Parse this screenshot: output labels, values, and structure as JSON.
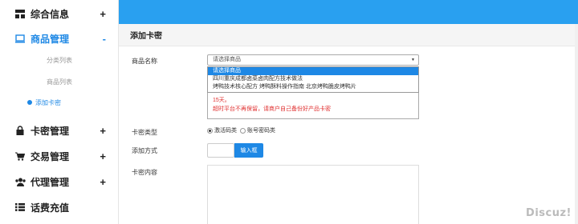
{
  "sidebar": {
    "groups": [
      {
        "label": "综合信息",
        "toggle": "+",
        "icon": "dashboard-icon"
      },
      {
        "label": "商品管理",
        "toggle": "-",
        "icon": "monitor-icon",
        "active": true
      },
      {
        "label": "卡密管理",
        "toggle": "+",
        "icon": "lock-icon"
      },
      {
        "label": "交易管理",
        "toggle": "+",
        "icon": "cart-icon"
      },
      {
        "label": "代理管理",
        "toggle": "+",
        "icon": "users-icon"
      },
      {
        "label": "话费充值",
        "toggle": "",
        "icon": "list-icon"
      }
    ],
    "sub_items": [
      "分类列表",
      "商品列表",
      "添加卡密"
    ]
  },
  "panel": {
    "title": "添加卡密"
  },
  "form": {
    "product_label": "商品名称",
    "select_value": "请选择商品",
    "dropdown_options": [
      "请选择商品",
      "四川重庆成都卤菜卤肉配方技术做法",
      "烤鸭技术核心配方 烤鸭酥料操作指南 北京烤鸭脆皮烤鸭片"
    ],
    "note_line1": "15天。",
    "note_line2": "超时平台不再保留，请商户自己备份好产品卡密",
    "type_label": "卡密类型",
    "radio_1": "激活码类",
    "radio_2": "账号密码类",
    "method_label": "添加方式",
    "method_button": "输入框",
    "content_label": "卡密内容"
  },
  "watermark": "Discuz!",
  "colors": {
    "accent": "#1e88e5",
    "topbar": "#29a0f0",
    "warning": "#e03030"
  }
}
